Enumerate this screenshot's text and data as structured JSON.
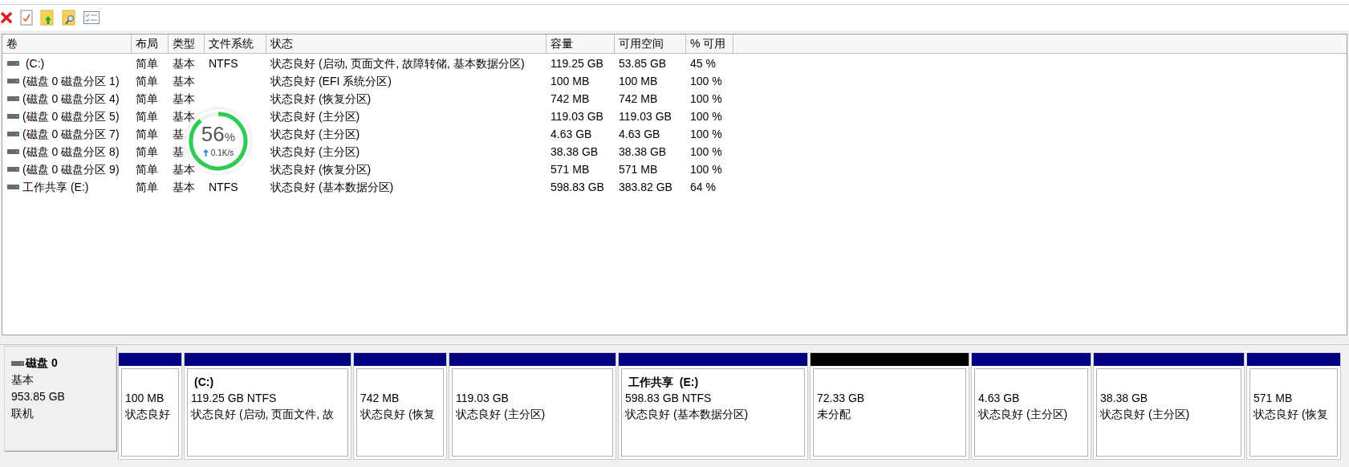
{
  "table": {
    "columns": [
      "卷",
      "布局",
      "类型",
      "文件系统",
      "状态",
      "容量",
      "可用空间",
      "% 可用"
    ],
    "rows": [
      {
        "volume": " (C:)",
        "layout": "简单",
        "type": "基本",
        "filesystem": "NTFS",
        "status": "状态良好 (启动, 页面文件, 故障转储, 基本数据分区)",
        "capacity": "119.25 GB",
        "free": "53.85 GB",
        "percent": "45 %"
      },
      {
        "volume": "(磁盘 0 磁盘分区 1)",
        "layout": "简单",
        "type": "基本",
        "status": "状态良好 (EFI 系统分区)",
        "capacity": "100 MB",
        "free": "100 MB",
        "percent": "100 %"
      },
      {
        "volume": "(磁盘 0 磁盘分区 4)",
        "layout": "简单",
        "type": "基本",
        "status": "状态良好 (恢复分区)",
        "capacity": "742 MB",
        "free": "742 MB",
        "percent": "100 %"
      },
      {
        "volume": "(磁盘 0 磁盘分区 5)",
        "layout": "简单",
        "type": "基本",
        "status": "状态良好 (主分区)",
        "capacity": "119.03 GB",
        "free": "119.03 GB",
        "percent": "100 %"
      },
      {
        "volume": "(磁盘 0 磁盘分区 7)",
        "layout": "简单",
        "type": "基",
        "status": "状态良好 (主分区)",
        "capacity": "4.63 GB",
        "free": "4.63 GB",
        "percent": "100 %"
      },
      {
        "volume": "(磁盘 0 磁盘分区 8)",
        "layout": "简单",
        "type": "基",
        "status": "状态良好 (主分区)",
        "capacity": "38.38 GB",
        "free": "38.38 GB",
        "percent": "100 %"
      },
      {
        "volume": "(磁盘 0 磁盘分区 9)",
        "layout": "简单",
        "type": "基本",
        "status": "状态良好 (恢复分区)",
        "capacity": "571 MB",
        "free": "571 MB",
        "percent": "100 %"
      },
      {
        "volume": "工作共享 (E:)",
        "layout": "简单",
        "type": "基本",
        "filesystem": "NTFS",
        "status": "状态良好 (基本数据分区)",
        "capacity": "598.83 GB",
        "free": "383.82 GB",
        "percent": "64 %"
      }
    ]
  },
  "overlay": {
    "percent": "56",
    "unit": "%",
    "speed": "0.1K/s"
  },
  "disk": {
    "name": "磁盘 0",
    "type": "基本",
    "size": "953.85 GB",
    "status": "联机",
    "partitions": [
      {
        "kind": "primary",
        "size": "100 MB",
        "status": "状态良好"
      },
      {
        "kind": "primary",
        "label": "(C:)",
        "size": "119.25 GB NTFS",
        "status": "状态良好 (启动, 页面文件, 故"
      },
      {
        "kind": "primary",
        "size": "742 MB",
        "status": "状态良好 (恢复"
      },
      {
        "kind": "primary",
        "size": "119.03 GB",
        "status": "状态良好 (主分区)"
      },
      {
        "kind": "primary",
        "label": "工作共享  (E:)",
        "size": "598.83 GB NTFS",
        "status": "状态良好 (基本数据分区)"
      },
      {
        "kind": "unallocated",
        "size": "72.33 GB",
        "status": "未分配"
      },
      {
        "kind": "primary",
        "size": "4.63 GB",
        "status": "状态良好 (主分区)"
      },
      {
        "kind": "primary",
        "size": "38.38 GB",
        "status": "状态良好 (主分区)"
      },
      {
        "kind": "primary",
        "size": "571 MB",
        "status": "状态良好 (恢复"
      }
    ]
  }
}
